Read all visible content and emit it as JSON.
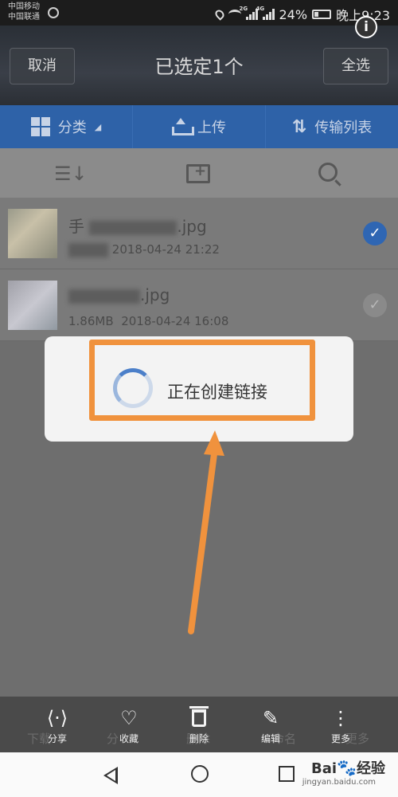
{
  "status_bar": {
    "carrier1": "中国移动",
    "carrier2": "中国联通",
    "net1": "2G",
    "net2": "4G",
    "battery": "24%",
    "time": "晚上9:23"
  },
  "header": {
    "cancel": "取消",
    "title": "已选定1个",
    "select_all": "全选",
    "info": "i"
  },
  "toolbar": {
    "category": "分类",
    "upload": "上传",
    "transfer": "传输列表"
  },
  "files": [
    {
      "name_visible": ".jpg",
      "name_prefix": "手    ",
      "date": "2018-04-24  21:22",
      "size": "",
      "checked": true
    },
    {
      "name_visible": ".jpg",
      "name_prefix": "",
      "date": "2018-04-24  16:08",
      "size": "1.86MB",
      "checked": false
    }
  ],
  "dialog": {
    "message": "正在创建链接"
  },
  "bottom_bar": {
    "ghost_labels": [
      "下载",
      "分",
      "删除",
      "命名",
      "更多"
    ],
    "actions": [
      "分享",
      "收藏",
      "删除",
      "编辑",
      "更多"
    ]
  },
  "watermark": {
    "brand": "Bai",
    "brand2": "经验",
    "url": "jingyan.baidu.com"
  },
  "colors": {
    "toolbar_blue": "#2e62a8",
    "highlight_orange": "#f0923d",
    "check_blue": "#2f66b3"
  }
}
